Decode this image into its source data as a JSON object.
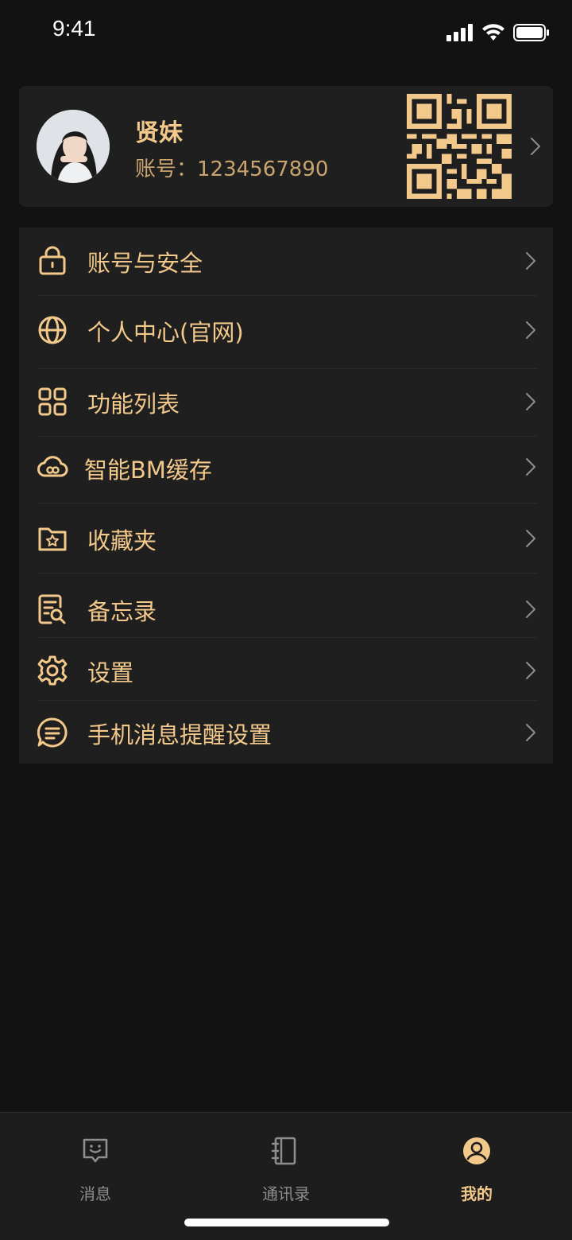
{
  "status_bar": {
    "time": "9:41",
    "icons": [
      "signal-icon",
      "wifi-icon",
      "battery-icon"
    ]
  },
  "profile": {
    "name": "贤妹",
    "account": "账号：1234567890",
    "avatar": "avatar",
    "qr_icon": "qr-code-icon"
  },
  "menu": {
    "items": [
      {
        "label": "账号与安全",
        "icon": "lock-icon"
      },
      {
        "label": "个人中心(官网)",
        "icon": "globe-icon"
      },
      {
        "label": "功能列表",
        "icon": "grid-icon"
      },
      {
        "label": "智能BM缓存",
        "icon": "cloud-icon"
      },
      {
        "label": "收藏夹",
        "icon": "star-folder-icon"
      },
      {
        "label": "备忘录",
        "icon": "note-icon"
      },
      {
        "label": "设置",
        "icon": "gear-icon"
      },
      {
        "label": "手机消息提醒设置",
        "icon": "message-icon"
      }
    ]
  },
  "tabs": [
    {
      "label": "消息",
      "icon": "chat-smile-icon",
      "active": false
    },
    {
      "label": "通讯录",
      "icon": "contacts-book-icon",
      "active": false
    },
    {
      "label": "我的",
      "icon": "user-icon",
      "active": true
    }
  ],
  "colors": {
    "accent": "#f3c98b",
    "background": "#121212",
    "card": "#1f1f1f",
    "inactive": "#8d8d8d"
  }
}
